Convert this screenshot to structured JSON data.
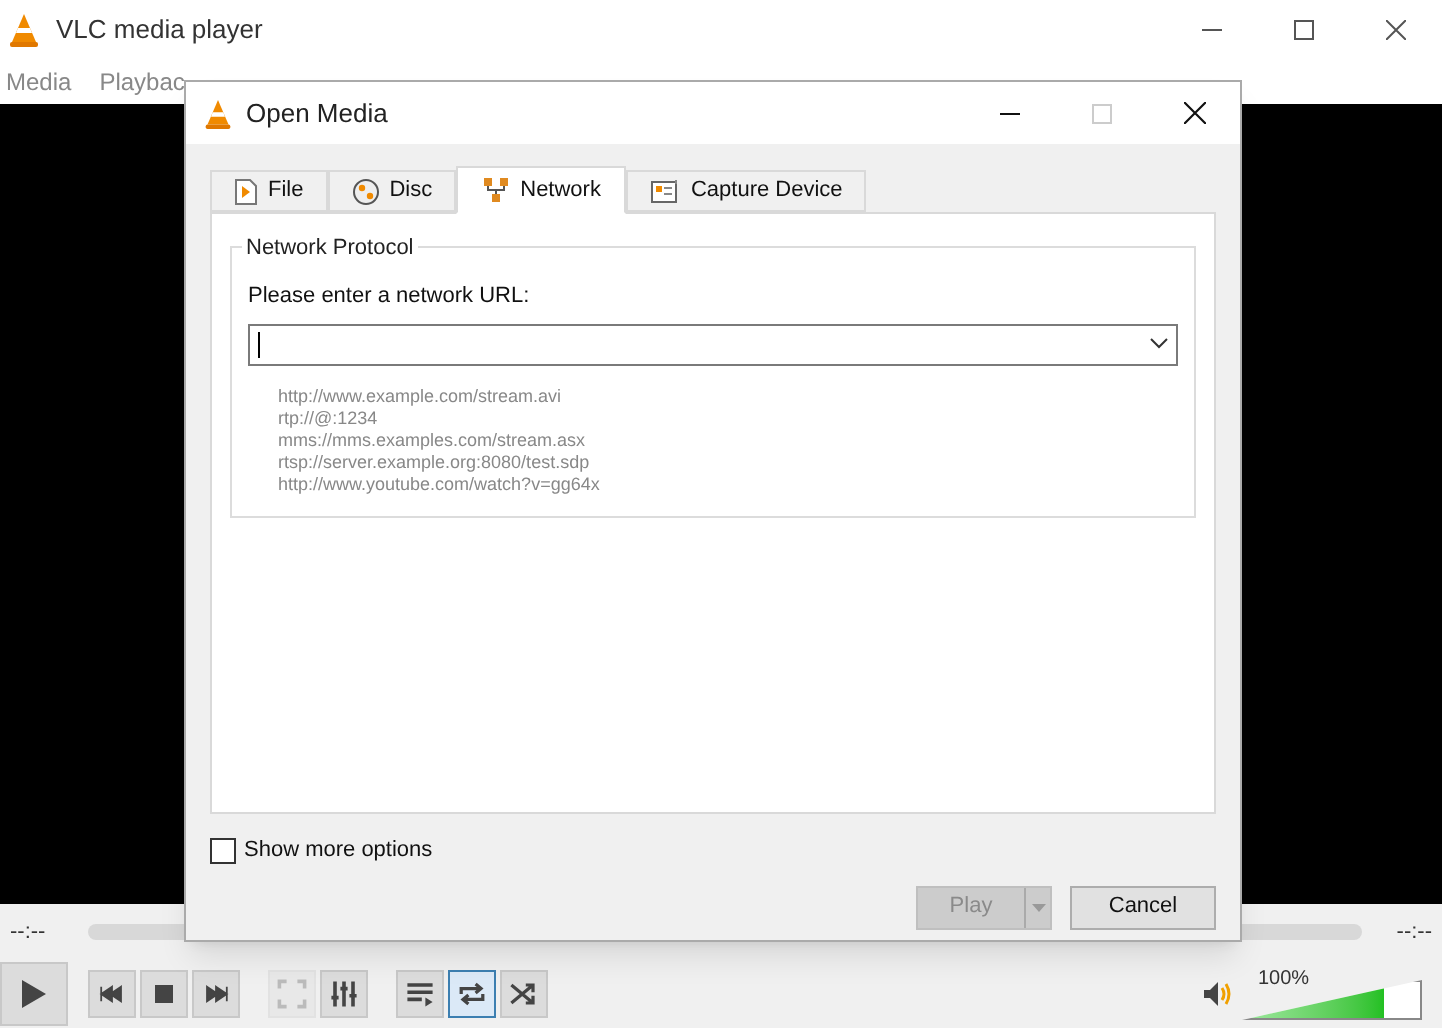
{
  "window": {
    "title": "VLC media player"
  },
  "menu": [
    "Media",
    "Playbac"
  ],
  "dialog": {
    "title": "Open Media",
    "tabs": [
      {
        "label": "File",
        "selected": false
      },
      {
        "label": "Disc",
        "selected": false
      },
      {
        "label": "Network",
        "selected": true
      },
      {
        "label": "Capture Device",
        "selected": false
      }
    ],
    "group_title": "Network Protocol",
    "url_label": "Please enter a network URL:",
    "examples": [
      "http://www.example.com/stream.avi",
      "rtp://@:1234",
      "mms://mms.examples.com/stream.asx",
      "rtsp://server.example.org:8080/test.sdp",
      "http://www.youtube.com/watch?v=gg64x"
    ],
    "show_more_options": {
      "label": "Show more options",
      "checked": false
    },
    "buttons": [
      {
        "label": "Play",
        "disabled": true,
        "kind": "split"
      },
      {
        "label": "Cancel",
        "disabled": false,
        "kind": "plain"
      }
    ]
  },
  "player": {
    "elapsed": "--:--",
    "remaining": "--:--",
    "controls": [
      {
        "kind": "play",
        "disabled": false,
        "selected": false
      },
      {
        "kind": "previous",
        "disabled": false,
        "selected": false
      },
      {
        "kind": "stop",
        "disabled": false,
        "selected": false
      },
      {
        "kind": "next",
        "disabled": false,
        "selected": false
      },
      {
        "kind": "fullscreen",
        "disabled": true,
        "selected": false
      },
      {
        "kind": "equalizer",
        "disabled": false,
        "selected": false
      },
      {
        "kind": "playlist",
        "disabled": false,
        "selected": false
      },
      {
        "kind": "loop",
        "disabled": false,
        "selected": true
      },
      {
        "kind": "random",
        "disabled": false,
        "selected": false
      }
    ],
    "volume": {
      "level": 0.8,
      "reading": "100%"
    }
  }
}
